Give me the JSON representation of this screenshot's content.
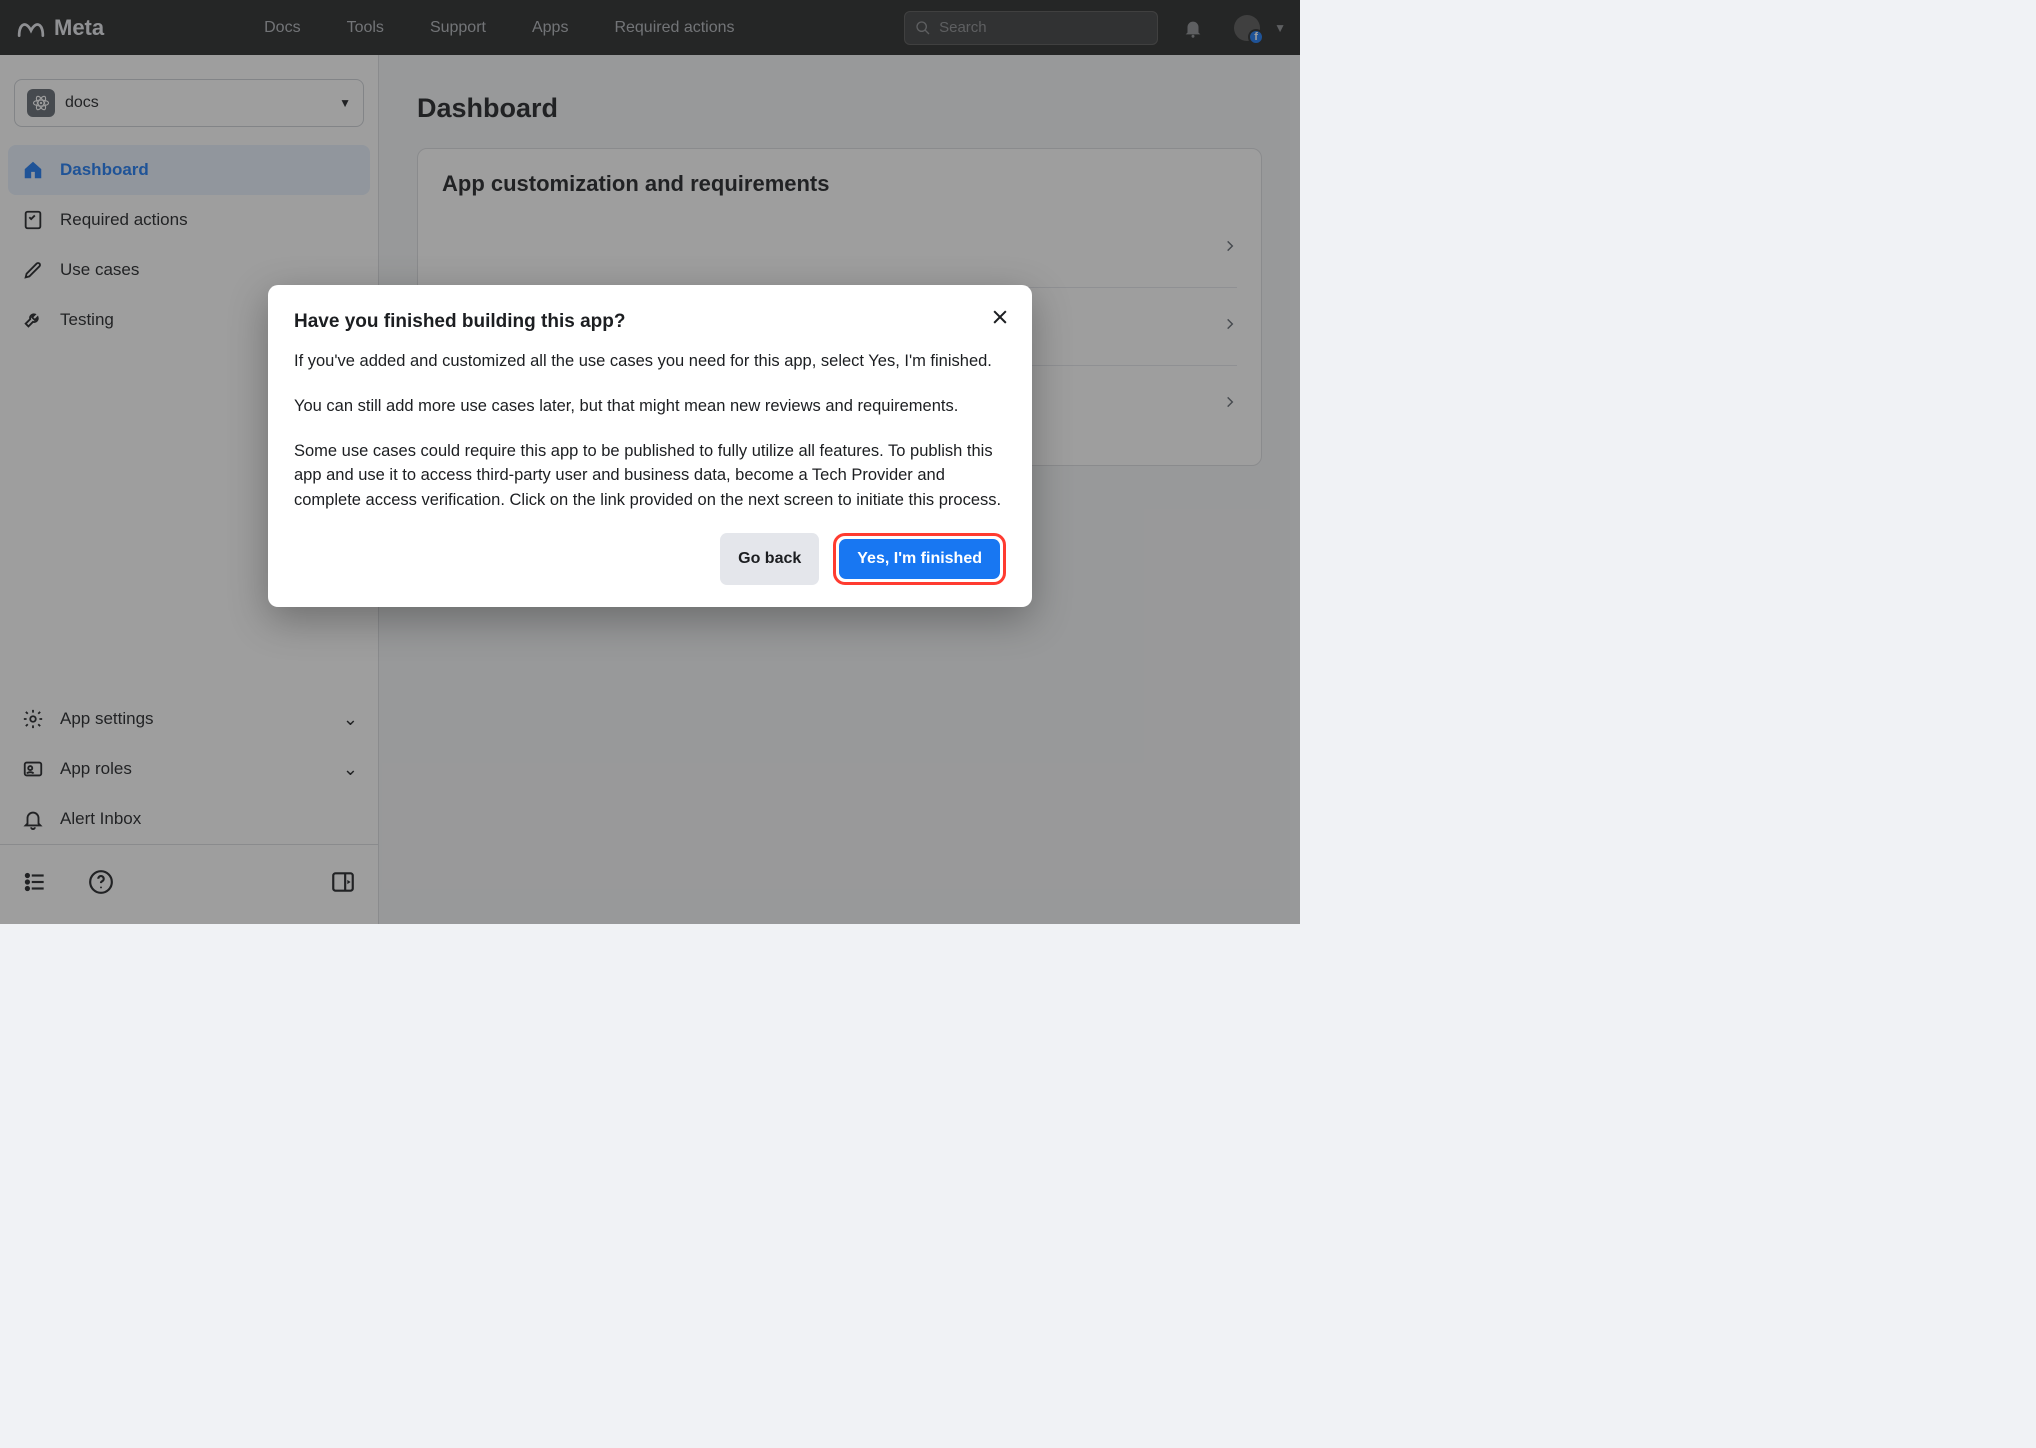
{
  "brand": {
    "name": "Meta"
  },
  "topnav": {
    "items": [
      "Docs",
      "Tools",
      "Support",
      "Apps",
      "Required actions"
    ],
    "search_placeholder": "Search"
  },
  "app_selector": {
    "name": "docs"
  },
  "sidebar": {
    "top": [
      {
        "label": "Dashboard",
        "active": true
      },
      {
        "label": "Required actions"
      },
      {
        "label": "Use cases"
      },
      {
        "label": "Testing"
      }
    ],
    "bottom": [
      {
        "label": "App settings",
        "expandable": true
      },
      {
        "label": "App roles",
        "expandable": true
      },
      {
        "label": "Alert Inbox"
      }
    ]
  },
  "page": {
    "title": "Dashboard",
    "card_title": "App customization and requirements"
  },
  "modal": {
    "title": "Have you finished building this app?",
    "p1": "If you've added and customized all the use cases you need for this app, select Yes, I'm finished.",
    "p2": "You can still add more use cases later, but that might mean new reviews and requirements.",
    "p3": "Some use cases could require this app to be published to fully utilize all features. To publish this app and use it to access third-party user and business data, become a Tech Provider and complete access verification. Click on the link provided on the next screen to initiate this process.",
    "go_back": "Go back",
    "finished": "Yes, I'm finished"
  }
}
